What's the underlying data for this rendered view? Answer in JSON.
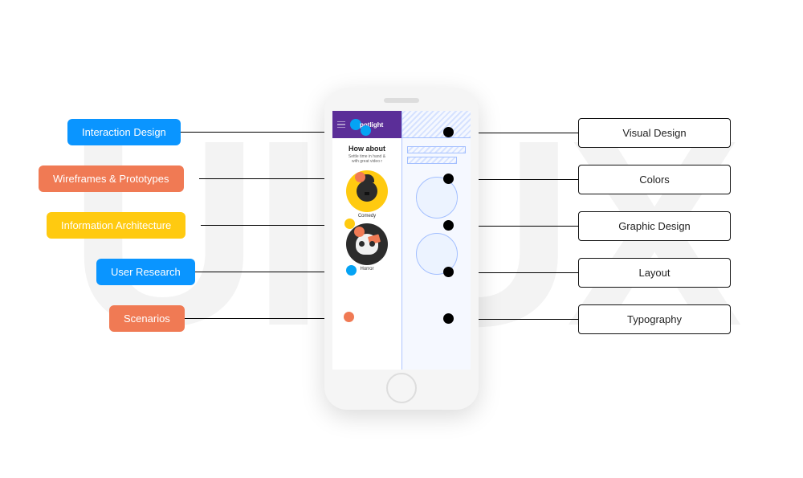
{
  "background_text": "UI UX",
  "phone": {
    "app_title": "potlight",
    "heading": "How about",
    "subtext_line1": "Settle time in hand &",
    "subtext_line2": "with great video r",
    "categories": [
      {
        "label": "Comedy"
      },
      {
        "label": "Horror"
      }
    ]
  },
  "left_labels": {
    "interaction_design": "Interaction Design",
    "wireframes": "Wireframes & Prototypes",
    "info_arch": "Information Architecture",
    "user_research": "User Research",
    "scenarios": "Scenarios"
  },
  "right_labels": {
    "visual_design": "Visual Design",
    "colors": "Colors",
    "graphic_design": "Graphic Design",
    "layout": "Layout",
    "typography": "Typography"
  },
  "colors": {
    "blue": "#0a95ff",
    "orange": "#f07a54",
    "yellow": "#ffca10",
    "purple": "#5b2e98"
  }
}
